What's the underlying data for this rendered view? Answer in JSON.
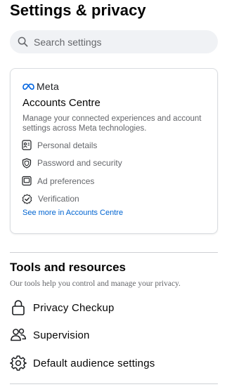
{
  "page": {
    "title": "Settings & privacy"
  },
  "search": {
    "placeholder": "Search settings",
    "icon": "search-icon"
  },
  "accounts_card": {
    "brand": "Meta",
    "title": "Accounts Centre",
    "description": "Manage your connected experiences and account settings across Meta technologies.",
    "items": [
      {
        "label": "Personal details",
        "icon": "id-card-icon"
      },
      {
        "label": "Password and security",
        "icon": "shield-icon"
      },
      {
        "label": "Ad preferences",
        "icon": "monitor-icon"
      },
      {
        "label": "Verification",
        "icon": "verified-badge-icon"
      }
    ],
    "see_more": "See more in Accounts Centre",
    "colors": {
      "brand_blue": "#0064e0",
      "link": "#0064d1"
    }
  },
  "tools": {
    "title": "Tools and resources",
    "subtitle": "Our tools help you control and manage your privacy.",
    "items": [
      {
        "label": "Privacy Checkup",
        "icon": "lock-icon"
      },
      {
        "label": "Supervision",
        "icon": "people-icon"
      },
      {
        "label": "Default audience settings",
        "icon": "gear-icon"
      }
    ]
  }
}
